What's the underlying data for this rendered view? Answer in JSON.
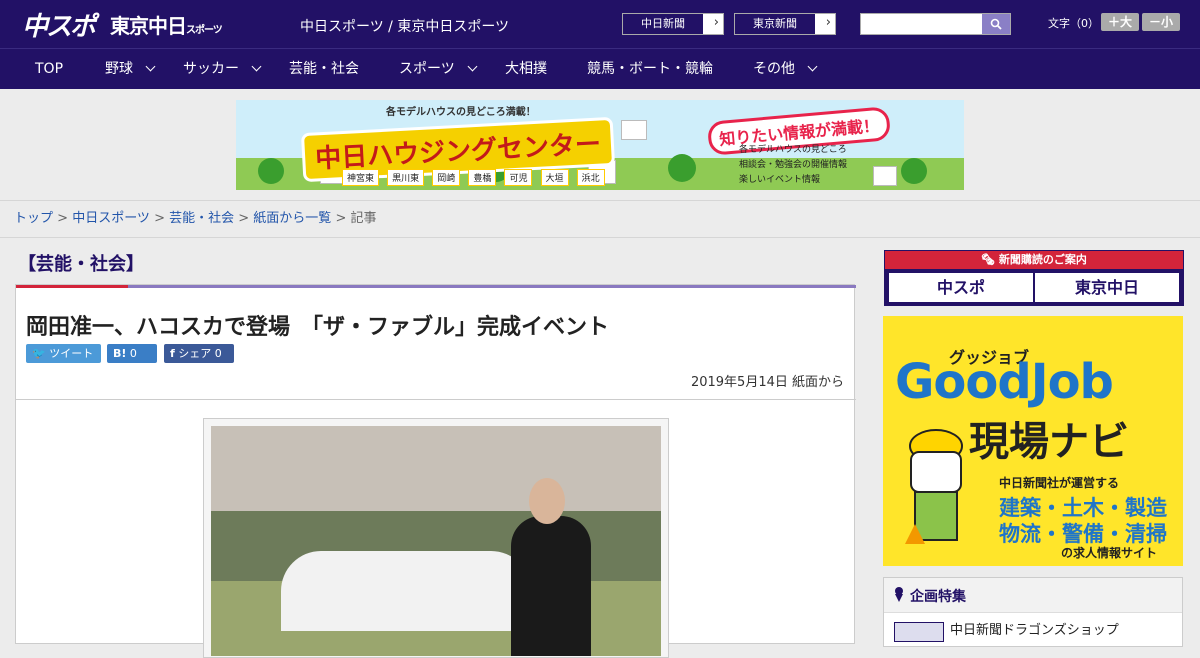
{
  "header": {
    "logo_chuspo": "中スポ",
    "logo_tokyo": "東京中日",
    "logo_tokyo_small": "スポーツ",
    "site_title": "中日スポーツ / 東京中日スポーツ",
    "paper_links": [
      {
        "label": "中日新聞"
      },
      {
        "label": "東京新聞"
      }
    ],
    "search_placeholder": "",
    "font_size_label": "文字（0）",
    "font_bigger": "＋大",
    "font_smaller": "－小"
  },
  "nav": {
    "items": [
      {
        "label": "TOP",
        "has_menu": false
      },
      {
        "label": "野球",
        "has_menu": true
      },
      {
        "label": "サッカー",
        "has_menu": true
      },
      {
        "label": "芸能・社会",
        "has_menu": false
      },
      {
        "label": "スポーツ",
        "has_menu": true
      },
      {
        "label": "大相撲",
        "has_menu": false
      },
      {
        "label": "競馬・ボート・競輪",
        "has_menu": false
      },
      {
        "label": "その他",
        "has_menu": true
      }
    ]
  },
  "banner": {
    "subtitle": "各モデルハウスの見どころ満載！",
    "title": "中日ハウジングセンター",
    "tagline": "知りたい情報が満載！",
    "bullets": [
      "各モデルハウスの見どころ",
      "相談会・勉強会の開催情報",
      "楽しいイベント情報"
    ],
    "cities": [
      "神宮東",
      "黒川東",
      "岡崎",
      "豊橋",
      "可児",
      "大垣",
      "浜北"
    ]
  },
  "breadcrumb": {
    "items": [
      "トップ",
      "中日スポーツ",
      "芸能・社会",
      "紙面から一覧"
    ],
    "current": "記事",
    "separator": " > "
  },
  "article": {
    "category": "【芸能・社会】",
    "headline": "岡田准一、ハコスカで登場　「ザ・ファブル」完成イベント",
    "share": {
      "tweet_label": "ツイート",
      "hatena_label": "B!",
      "hatena_count": "0",
      "facebook_label": "シェア",
      "facebook_count": "0"
    },
    "date": "2019年5月14日 紙面から"
  },
  "sidebar": {
    "subscribe_header": "新聞購読のご案内",
    "subscribe_links": [
      "中スポ",
      "東京中日"
    ],
    "goodjob": {
      "kana": "グッジョブ",
      "logo": "GoodJob",
      "name": "現場ナビ",
      "line1": "中日新聞社が運営する",
      "line2": "建築・土木・製造",
      "line3": "物流・警備・清掃",
      "line4": "の求人情報サイト"
    },
    "feature_header": "企画特集",
    "feature_item": "中日新聞ドラゴンズショップ"
  },
  "colors": {
    "brand_navy": "#221166",
    "accent_red": "#d3243a",
    "twitter": "#4c9ad8",
    "facebook": "#3b5998"
  }
}
